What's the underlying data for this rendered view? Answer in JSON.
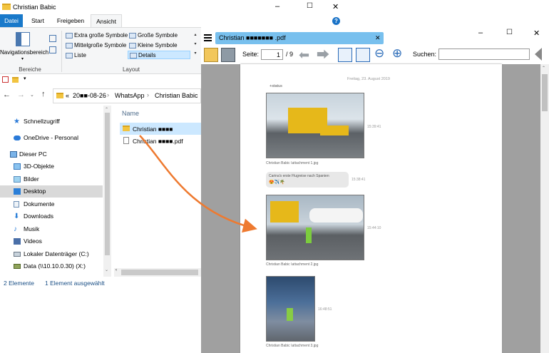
{
  "explorer": {
    "title": "Christian Babic",
    "ribbon_tabs": [
      "Datei",
      "Start",
      "Freigeben",
      "Ansicht"
    ],
    "ribbon": {
      "nav_pane_label": "Navigationsbereich",
      "views": [
        "Extra große Symbole",
        "Große Symbole",
        "Mittelgroße Symbole",
        "Kleine Symbole",
        "Liste",
        "Details"
      ],
      "group_left": "Bereiche",
      "group_right": "Layout"
    },
    "address": {
      "prefix": "«",
      "segments": [
        "20■■-08-26",
        "WhatsApp",
        "Christian Babic"
      ]
    },
    "nav_items": [
      {
        "label": "Schnellzugriff",
        "icon": "star-icon"
      },
      {
        "label": "OneDrive - Personal",
        "icon": "cloud-icon"
      },
      {
        "label": "Dieser PC",
        "icon": "computer-icon"
      },
      {
        "label": "3D-Objekte",
        "icon": "cube-icon"
      },
      {
        "label": "Bilder",
        "icon": "pictures-icon"
      },
      {
        "label": "Desktop",
        "icon": "desktop-icon"
      },
      {
        "label": "Dokumente",
        "icon": "documents-icon"
      },
      {
        "label": "Downloads",
        "icon": "download-icon"
      },
      {
        "label": "Musik",
        "icon": "music-icon"
      },
      {
        "label": "Videos",
        "icon": "videos-icon"
      },
      {
        "label": "Lokaler Datenträger (C:)",
        "icon": "drive-icon"
      },
      {
        "label": "Data (\\\\10.10.0.30) (X:)",
        "icon": "network-drive-icon"
      }
    ],
    "column_name": "Name",
    "files": [
      {
        "name": "Christian ■■■■",
        "icon": "folder-icon"
      },
      {
        "name": "Christian ■■■■.pdf",
        "icon": "pdf-icon"
      }
    ],
    "status": {
      "count": "2 Elemente",
      "selected": "1 Element ausgewählt"
    }
  },
  "window_controls": {
    "min": "–",
    "max": "☐",
    "close": "✕",
    "help": "?"
  },
  "viewer": {
    "tab_title": "Christian ■■■■■■■ .pdf",
    "tab_close": "✕",
    "page_label": "Seite:",
    "page_current": "1",
    "page_total": "/ 9",
    "search_label": "Suchen:",
    "search_value": ""
  },
  "document": {
    "date": "Freitag, 23. August 2019",
    "status_line": "+status",
    "message_text": "Carina's erste Flugreise nach Spanien",
    "message_emoji": "😍✈️🌴",
    "message_time": "15:38:41",
    "entries": [
      {
        "caption": "Christian Babic \\attachment 1.jpg",
        "time": "15:39:41"
      },
      {
        "caption": "Christian Babic \\attachment 2.jpg",
        "time": "15:44:10"
      },
      {
        "caption": "Christian Babic \\attachment 3.jpg",
        "time": "16:48:51"
      }
    ]
  },
  "colors": {
    "accent": "#0063b1",
    "arrow": "#ee7a30",
    "tab_blue": "#78c0ee"
  }
}
